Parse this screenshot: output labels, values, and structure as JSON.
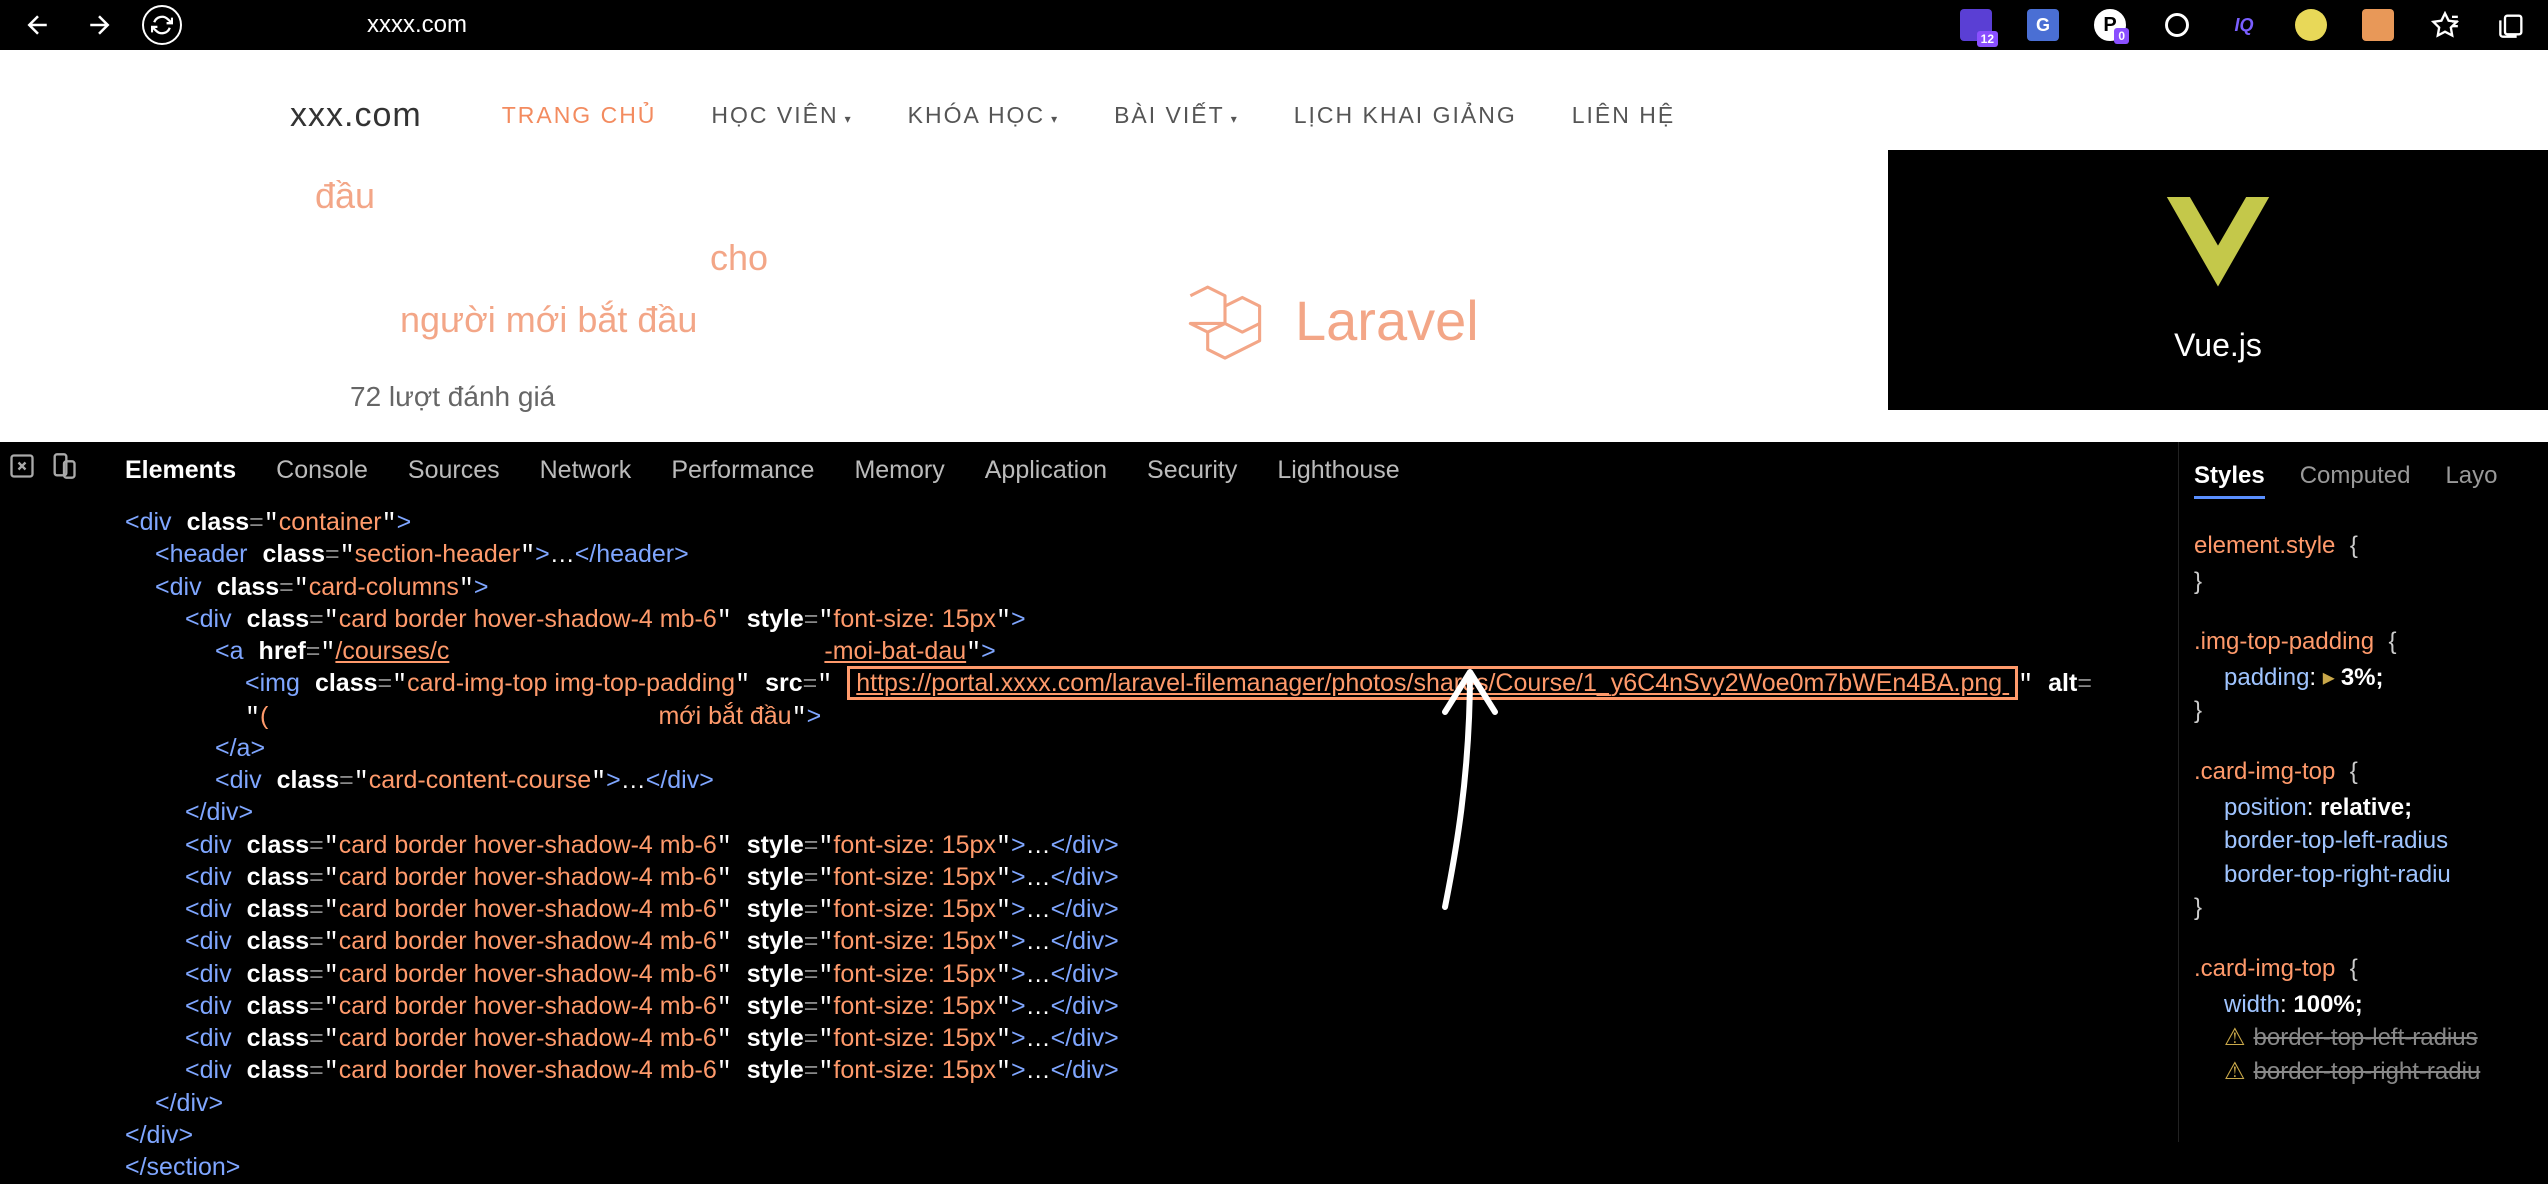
{
  "browser": {
    "url": "xxxx.com",
    "ext_badge_1": "12",
    "ext_badge_2": "0"
  },
  "site": {
    "logo": "xxx.com",
    "nav": [
      {
        "label": "TRANG CHỦ",
        "active": true,
        "dropdown": false
      },
      {
        "label": "HỌC VIÊN",
        "active": false,
        "dropdown": true
      },
      {
        "label": "KHÓA HỌC",
        "active": false,
        "dropdown": true
      },
      {
        "label": "BÀI VIẾT",
        "active": false,
        "dropdown": true
      },
      {
        "label": "LỊCH KHAI GIẢNG",
        "active": false,
        "dropdown": false
      },
      {
        "label": "LIÊN HỆ",
        "active": false,
        "dropdown": false
      }
    ],
    "hero_line1": "đầu",
    "hero_line2": "cho",
    "hero_line3": "người mới bắt đầu",
    "hero_sub": "72 lượt đánh giá",
    "laravel_text": "Laravel",
    "vue_text": "Vue.js"
  },
  "devtools": {
    "tabs": [
      "Elements",
      "Console",
      "Sources",
      "Network",
      "Performance",
      "Memory",
      "Application",
      "Security",
      "Lighthouse"
    ],
    "active_tab": "Elements",
    "side_tabs": [
      "Styles",
      "Computed",
      "Layo"
    ],
    "active_side_tab": "Styles",
    "dom": {
      "container_class": "container",
      "header_class": "section-header",
      "columns_class": "card-columns",
      "card_class": "card border hover-shadow-4 mb-6",
      "card_style": "font-size: 15px",
      "a_href": "/courses/c",
      "a_href_tail": "-moi-bat-dau",
      "img_class": "card-img-top img-top-padding",
      "img_src": "https://portal.xxxx.com/laravel-filemanager/photos/shares/Course/1_y6C4nSvy2Woe0m7bWEn4BA.png ",
      "img_alt_fragment": "mới bắt đầu",
      "card_content_class": "card-content-course",
      "repeat_cards": 8
    },
    "styles": {
      "element_style": "element.style",
      "rule1_selector": ".img-top-padding",
      "rule1_prop": "padding",
      "rule1_val": "3%;",
      "rule2_selector": ".card-img-top",
      "rule2_prop1": "position",
      "rule2_val1": "relative;",
      "rule2_prop2": "border-top-left-radius",
      "rule2_prop3": "border-top-right-radiu",
      "rule3_selector": ".card-img-top",
      "rule3_prop1": "width",
      "rule3_val1": "100%;",
      "rule3_prop2": "border-top-left-radius",
      "rule3_prop3": "border-top-right-radiu"
    }
  }
}
